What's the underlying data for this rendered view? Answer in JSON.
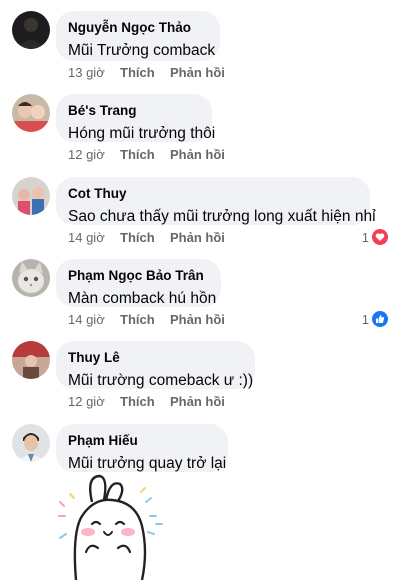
{
  "actions": {
    "like": "Thích",
    "reply": "Phản hồi"
  },
  "comments": [
    {
      "author": "Nguyễn Ngọc Thảo",
      "text": "Mũi Trưởng comback",
      "time": "13 giờ"
    },
    {
      "author": "Bé's Trang",
      "text": "Hóng mũi trưởng thôi",
      "time": "12 giờ"
    },
    {
      "author": "Cot Thuy",
      "text": "Sao chưa thấy mũi trưởng long xuất hiện nhỉ",
      "time": "14 giờ",
      "reaction": {
        "count": "1",
        "icon": "heart-icon",
        "color": "#f33e58"
      }
    },
    {
      "author": "Phạm Ngọc Bảo Trân",
      "text": "Màn comback hú hồn",
      "time": "14 giờ",
      "reaction": {
        "count": "1",
        "icon": "thumbs-up-icon",
        "color": "#1877f2"
      }
    },
    {
      "author": "Thuy Lê",
      "text": "Mũi trường comeback ư :))",
      "time": "12 giờ"
    },
    {
      "author": "Phạm Hiếu",
      "text": "Mũi trưởng quay trở lại"
    }
  ],
  "colors": {
    "bubble": "#f0f2f5",
    "meta_text": "#65676b",
    "name": "#050505"
  }
}
